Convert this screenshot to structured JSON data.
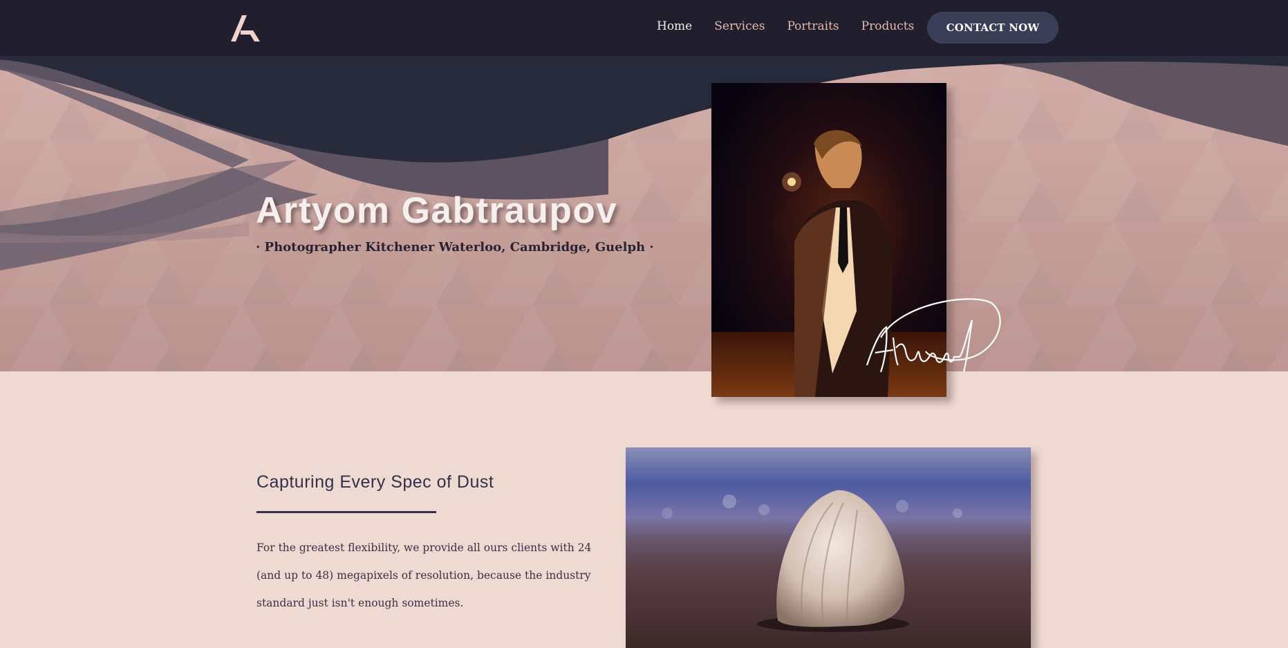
{
  "brand": {
    "logo_icon": "stylized-a-logo-icon",
    "logo_color": "#efd3cc"
  },
  "nav": {
    "links": [
      "Home",
      "Services",
      "Portraits",
      "Products"
    ],
    "active": "Home",
    "cta_label": "CONTACT NOW"
  },
  "hero": {
    "name": "Artyom Gabtraupov",
    "tagline": "· Photographer Kitchener Waterloo, Cambridge, Guelph ·",
    "portrait_photo": "portrait-photo",
    "signature": "Artyom G"
  },
  "feature": {
    "title": "Capturing Every Spec of Dust",
    "body": "For the greatest flexibility, we provide all ours clients with 24 (and up to 48) megapixels of resolution, because the industry standard just isn't enough sometimes.",
    "photo": "seashell-photo"
  },
  "colors": {
    "nav_bg": "#211f2d",
    "nav_link": "#e6b9ad",
    "cta_bg": "#3a3f57",
    "page_bg": "#efd9d3",
    "hero_navy": "#272a3a",
    "hero_pink": "#c9a39d",
    "text_dark": "#33304a"
  }
}
